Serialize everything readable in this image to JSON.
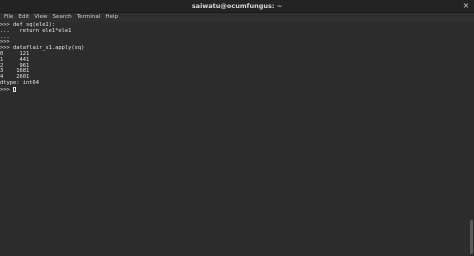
{
  "window": {
    "title": "saiwatu@ocumfungus: ~",
    "close_glyph": "×"
  },
  "menu": {
    "items": [
      "File",
      "Edit",
      "View",
      "Search",
      "Terminal",
      "Help"
    ]
  },
  "terminal": {
    "lines": [
      ">>> def sq(ele1):",
      "...   return ele1*ele1",
      "...",
      ">>>",
      ">>> dataflair_s1.apply(sq)",
      "0     121",
      "1     441",
      "2     961",
      "3    1681",
      "4    2601",
      "dtype: int64"
    ],
    "prompt": ">>> "
  }
}
